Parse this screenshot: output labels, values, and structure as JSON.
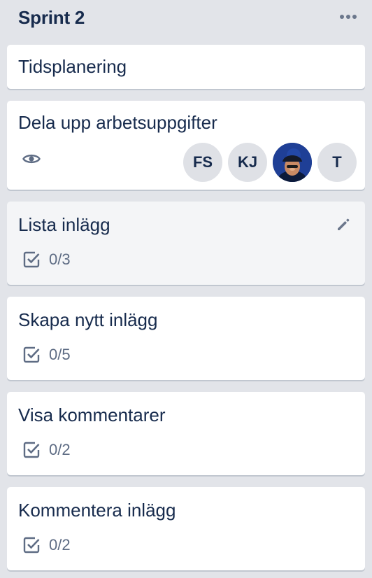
{
  "list": {
    "title": "Sprint 2"
  },
  "cards": [
    {
      "title": "Tidsplanering"
    },
    {
      "title": "Dela upp arbetsuppgifter",
      "members": [
        {
          "initials": "FS"
        },
        {
          "initials": "KJ"
        },
        {
          "initials": "",
          "photo": true
        },
        {
          "initials": "T"
        }
      ]
    },
    {
      "title": "Lista inlägg",
      "checklist": "0/3"
    },
    {
      "title": "Skapa nytt inlägg",
      "checklist": "0/5"
    },
    {
      "title": "Visa kommentarer",
      "checklist": "0/2"
    },
    {
      "title": "Kommentera inlägg",
      "checklist": "0/2"
    }
  ],
  "colors": {
    "list_bg": "#e2e4e9",
    "card_bg": "#ffffff",
    "text": "#172b4d",
    "muted": "#5e6c84",
    "avatar_bg": "#dfe1e6"
  },
  "icons": [
    "more-icon",
    "eye-icon",
    "pencil-icon",
    "checklist-icon"
  ]
}
